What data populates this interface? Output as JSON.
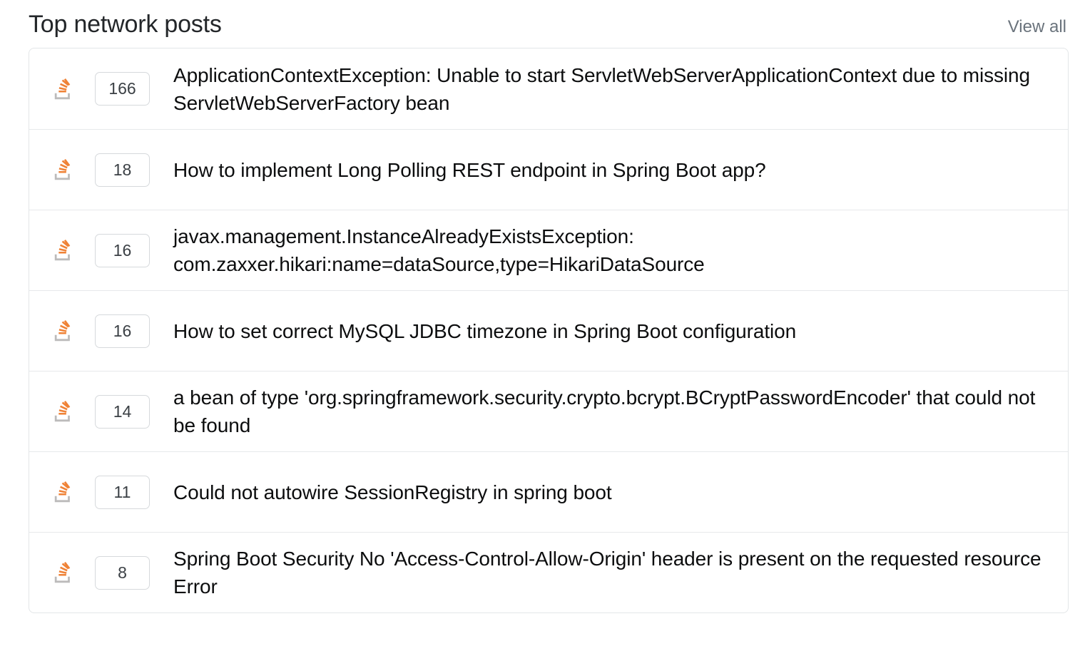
{
  "module": {
    "title": "Top network posts",
    "view_all_label": "View all"
  },
  "colors": {
    "title_text": "#232629",
    "link_muted": "#6a737c",
    "post_title": "#0c0d0e",
    "badge_border": "#d6d9dc",
    "badge_text": "#3b4045",
    "card_border": "#e3e6e8",
    "row_divider": "#e7e9eb",
    "stackoverflow_orange": "#ef8236",
    "stackoverflow_gray": "#bcbbbb"
  },
  "posts": [
    {
      "site_icon": "stackoverflow-icon",
      "score": "166",
      "title": "ApplicationContextException: Unable to start ServletWebServerApplicationContext due to missing ServletWebServerFactory bean"
    },
    {
      "site_icon": "stackoverflow-icon",
      "score": "18",
      "title": "How to implement Long Polling REST endpoint in Spring Boot app?"
    },
    {
      "site_icon": "stackoverflow-icon",
      "score": "16",
      "title": "javax.management.InstanceAlreadyExistsException: com.zaxxer.hikari:name=dataSource,type=HikariDataSource"
    },
    {
      "site_icon": "stackoverflow-icon",
      "score": "16",
      "title": "How to set correct MySQL JDBC timezone in Spring Boot configuration"
    },
    {
      "site_icon": "stackoverflow-icon",
      "score": "14",
      "title": "a bean of type 'org.springframework.security.crypto.bcrypt.BCryptPasswordEncoder' that could not be found"
    },
    {
      "site_icon": "stackoverflow-icon",
      "score": "11",
      "title": "Could not autowire SessionRegistry in spring boot"
    },
    {
      "site_icon": "stackoverflow-icon",
      "score": "8",
      "title": "Spring Boot Security No 'Access-Control-Allow-Origin' header is present on the requested resource Error"
    }
  ]
}
